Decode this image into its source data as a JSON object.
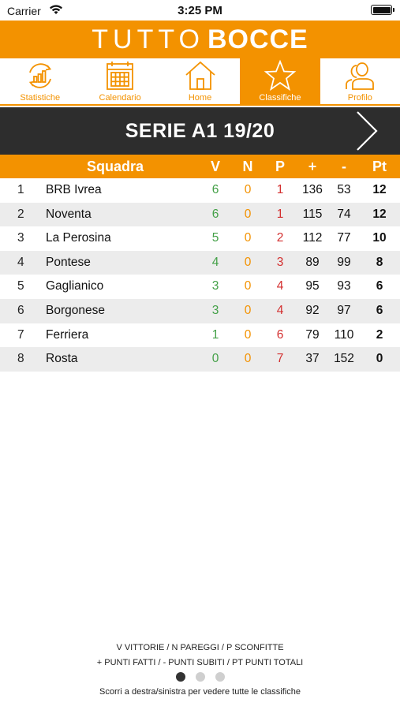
{
  "status_bar": {
    "carrier": "Carrier",
    "time": "3:25 PM"
  },
  "header": {
    "brand_light": "TUTTO",
    "brand_bold": "BOCCE",
    "accent_color": "#f39200"
  },
  "tabs": [
    {
      "label": "Statistiche",
      "icon": "chart-icon",
      "active": false
    },
    {
      "label": "Calendario",
      "icon": "calendar-icon",
      "active": false
    },
    {
      "label": "Home",
      "icon": "home-icon",
      "active": false
    },
    {
      "label": "Classifiche",
      "icon": "star-icon",
      "active": true
    },
    {
      "label": "Profilo",
      "icon": "users-icon",
      "active": false
    }
  ],
  "series": {
    "title": "SERIE A1 19/20",
    "next_icon": "chevron-right-icon"
  },
  "table": {
    "headers": {
      "team": "Squadra",
      "v": "V",
      "n": "N",
      "p": "P",
      "plus": "+",
      "minus": "-",
      "pt": "Pt"
    },
    "rows": [
      {
        "pos": "1",
        "team": "BRB Ivrea",
        "v": "6",
        "n": "0",
        "p": "1",
        "plus": "136",
        "minus": "53",
        "pt": "12"
      },
      {
        "pos": "2",
        "team": "Noventa",
        "v": "6",
        "n": "0",
        "p": "1",
        "plus": "115",
        "minus": "74",
        "pt": "12"
      },
      {
        "pos": "3",
        "team": "La Perosina",
        "v": "5",
        "n": "0",
        "p": "2",
        "plus": "112",
        "minus": "77",
        "pt": "10"
      },
      {
        "pos": "4",
        "team": "Pontese",
        "v": "4",
        "n": "0",
        "p": "3",
        "plus": "89",
        "minus": "99",
        "pt": "8"
      },
      {
        "pos": "5",
        "team": "Gaglianico",
        "v": "3",
        "n": "0",
        "p": "4",
        "plus": "95",
        "minus": "93",
        "pt": "6"
      },
      {
        "pos": "6",
        "team": "Borgonese",
        "v": "3",
        "n": "0",
        "p": "4",
        "plus": "92",
        "minus": "97",
        "pt": "6"
      },
      {
        "pos": "7",
        "team": "Ferriera",
        "v": "1",
        "n": "0",
        "p": "6",
        "plus": "79",
        "minus": "110",
        "pt": "2"
      },
      {
        "pos": "8",
        "team": "Rosta",
        "v": "0",
        "n": "0",
        "p": "7",
        "plus": "37",
        "minus": "152",
        "pt": "0"
      }
    ]
  },
  "footer": {
    "legend_line1": "V VITTORIE / N PAREGGI / P SCONFITTE",
    "legend_line2": "+ PUNTI FATTI / - PUNTI SUBITI / PT PUNTI TOTALI",
    "page_count": 3,
    "current_page": 1,
    "hint": "Scorri a destra/sinistra per vedere tutte le classifiche"
  }
}
